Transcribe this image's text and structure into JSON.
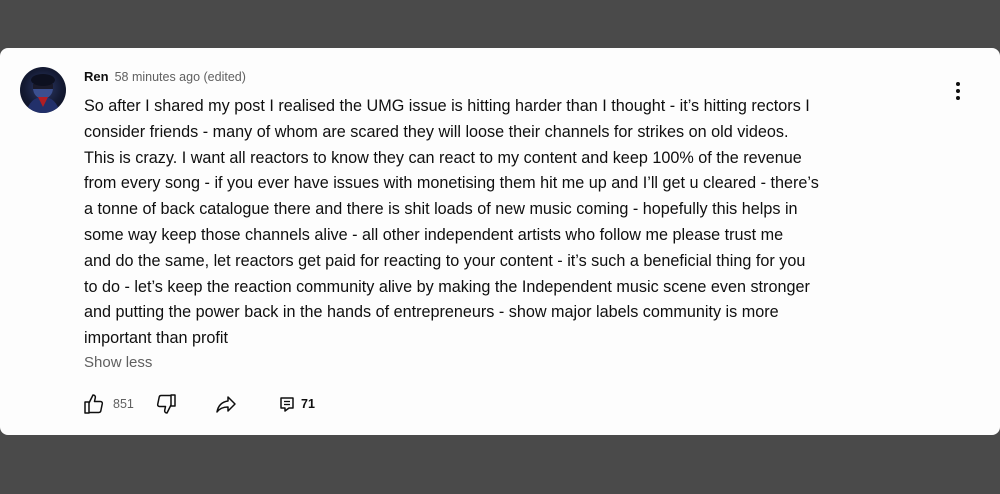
{
  "comment": {
    "author": "Ren",
    "meta": "58 minutes ago (edited)",
    "lines": [
      "So after I shared my post I realised the UMG issue is hitting harder than I thought - it’s hitting rectors I",
      "consider friends - many of whom are scared they will loose their channels for strikes on old videos.",
      "This is crazy. I want all reactors to know they can react to my content and keep 100% of the revenue",
      "from every song - if you ever have issues with monetising them hit me up and I’ll get u cleared - there’s",
      "a tonne of back catalogue there and there is shit loads of new music coming - hopefully this helps in",
      "some way  keep those channels alive - all other independent artists who follow me  please trust me",
      "and do the same, let reactors get paid for reacting to your content  - it’s such a beneficial thing for you",
      "to do - let’s keep the reaction community alive by making the Independent music scene even stronger",
      "and putting the power back in the hands of entrepreneurs - show major labels community is more",
      "important than profit"
    ],
    "show_less": "Show less",
    "like_count": "851",
    "reply_count": "71"
  },
  "icons": {
    "avatar": "avatar-image",
    "more": "more-vert-icon",
    "like": "thumbs-up-icon",
    "dislike": "thumbs-down-icon",
    "share": "share-icon",
    "replies": "comment-icon"
  },
  "colors": {
    "page_bg": "#4a4a4a",
    "card_bg": "#fdfdfd",
    "text": "#0f0f0f",
    "secondary_text": "#606060"
  }
}
